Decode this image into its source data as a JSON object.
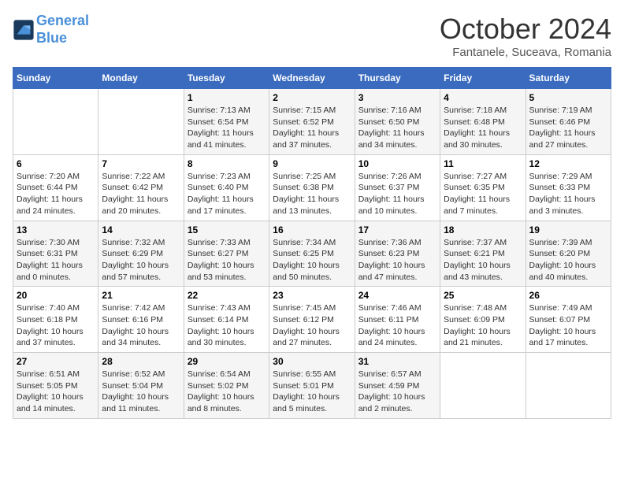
{
  "header": {
    "logo_line1": "General",
    "logo_line2": "Blue",
    "month_title": "October 2024",
    "subtitle": "Fantanele, Suceava, Romania"
  },
  "days_of_week": [
    "Sunday",
    "Monday",
    "Tuesday",
    "Wednesday",
    "Thursday",
    "Friday",
    "Saturday"
  ],
  "weeks": [
    [
      {
        "num": "",
        "info": ""
      },
      {
        "num": "",
        "info": ""
      },
      {
        "num": "1",
        "info": "Sunrise: 7:13 AM\nSunset: 6:54 PM\nDaylight: 11 hours and 41 minutes."
      },
      {
        "num": "2",
        "info": "Sunrise: 7:15 AM\nSunset: 6:52 PM\nDaylight: 11 hours and 37 minutes."
      },
      {
        "num": "3",
        "info": "Sunrise: 7:16 AM\nSunset: 6:50 PM\nDaylight: 11 hours and 34 minutes."
      },
      {
        "num": "4",
        "info": "Sunrise: 7:18 AM\nSunset: 6:48 PM\nDaylight: 11 hours and 30 minutes."
      },
      {
        "num": "5",
        "info": "Sunrise: 7:19 AM\nSunset: 6:46 PM\nDaylight: 11 hours and 27 minutes."
      }
    ],
    [
      {
        "num": "6",
        "info": "Sunrise: 7:20 AM\nSunset: 6:44 PM\nDaylight: 11 hours and 24 minutes."
      },
      {
        "num": "7",
        "info": "Sunrise: 7:22 AM\nSunset: 6:42 PM\nDaylight: 11 hours and 20 minutes."
      },
      {
        "num": "8",
        "info": "Sunrise: 7:23 AM\nSunset: 6:40 PM\nDaylight: 11 hours and 17 minutes."
      },
      {
        "num": "9",
        "info": "Sunrise: 7:25 AM\nSunset: 6:38 PM\nDaylight: 11 hours and 13 minutes."
      },
      {
        "num": "10",
        "info": "Sunrise: 7:26 AM\nSunset: 6:37 PM\nDaylight: 11 hours and 10 minutes."
      },
      {
        "num": "11",
        "info": "Sunrise: 7:27 AM\nSunset: 6:35 PM\nDaylight: 11 hours and 7 minutes."
      },
      {
        "num": "12",
        "info": "Sunrise: 7:29 AM\nSunset: 6:33 PM\nDaylight: 11 hours and 3 minutes."
      }
    ],
    [
      {
        "num": "13",
        "info": "Sunrise: 7:30 AM\nSunset: 6:31 PM\nDaylight: 11 hours and 0 minutes."
      },
      {
        "num": "14",
        "info": "Sunrise: 7:32 AM\nSunset: 6:29 PM\nDaylight: 10 hours and 57 minutes."
      },
      {
        "num": "15",
        "info": "Sunrise: 7:33 AM\nSunset: 6:27 PM\nDaylight: 10 hours and 53 minutes."
      },
      {
        "num": "16",
        "info": "Sunrise: 7:34 AM\nSunset: 6:25 PM\nDaylight: 10 hours and 50 minutes."
      },
      {
        "num": "17",
        "info": "Sunrise: 7:36 AM\nSunset: 6:23 PM\nDaylight: 10 hours and 47 minutes."
      },
      {
        "num": "18",
        "info": "Sunrise: 7:37 AM\nSunset: 6:21 PM\nDaylight: 10 hours and 43 minutes."
      },
      {
        "num": "19",
        "info": "Sunrise: 7:39 AM\nSunset: 6:20 PM\nDaylight: 10 hours and 40 minutes."
      }
    ],
    [
      {
        "num": "20",
        "info": "Sunrise: 7:40 AM\nSunset: 6:18 PM\nDaylight: 10 hours and 37 minutes."
      },
      {
        "num": "21",
        "info": "Sunrise: 7:42 AM\nSunset: 6:16 PM\nDaylight: 10 hours and 34 minutes."
      },
      {
        "num": "22",
        "info": "Sunrise: 7:43 AM\nSunset: 6:14 PM\nDaylight: 10 hours and 30 minutes."
      },
      {
        "num": "23",
        "info": "Sunrise: 7:45 AM\nSunset: 6:12 PM\nDaylight: 10 hours and 27 minutes."
      },
      {
        "num": "24",
        "info": "Sunrise: 7:46 AM\nSunset: 6:11 PM\nDaylight: 10 hours and 24 minutes."
      },
      {
        "num": "25",
        "info": "Sunrise: 7:48 AM\nSunset: 6:09 PM\nDaylight: 10 hours and 21 minutes."
      },
      {
        "num": "26",
        "info": "Sunrise: 7:49 AM\nSunset: 6:07 PM\nDaylight: 10 hours and 17 minutes."
      }
    ],
    [
      {
        "num": "27",
        "info": "Sunrise: 6:51 AM\nSunset: 5:05 PM\nDaylight: 10 hours and 14 minutes."
      },
      {
        "num": "28",
        "info": "Sunrise: 6:52 AM\nSunset: 5:04 PM\nDaylight: 10 hours and 11 minutes."
      },
      {
        "num": "29",
        "info": "Sunrise: 6:54 AM\nSunset: 5:02 PM\nDaylight: 10 hours and 8 minutes."
      },
      {
        "num": "30",
        "info": "Sunrise: 6:55 AM\nSunset: 5:01 PM\nDaylight: 10 hours and 5 minutes."
      },
      {
        "num": "31",
        "info": "Sunrise: 6:57 AM\nSunset: 4:59 PM\nDaylight: 10 hours and 2 minutes."
      },
      {
        "num": "",
        "info": ""
      },
      {
        "num": "",
        "info": ""
      }
    ]
  ]
}
